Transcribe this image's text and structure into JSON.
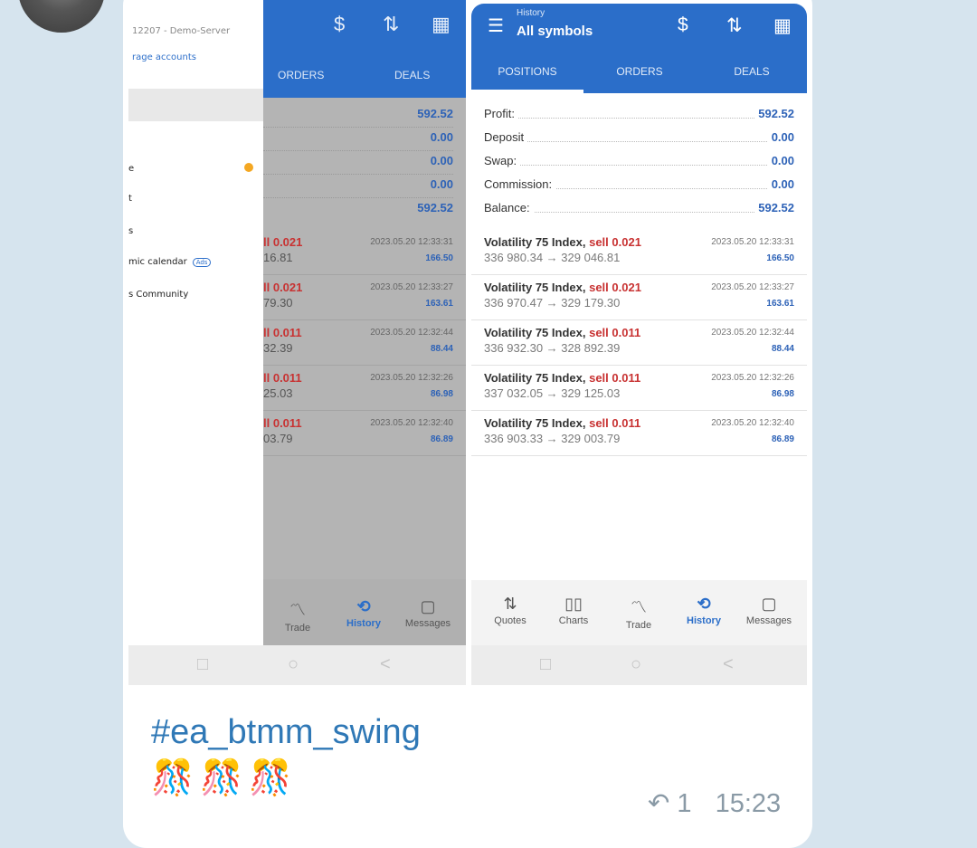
{
  "left_screen": {
    "drawer": {
      "server": "12207 - Demo-Server",
      "manage_accounts": "rage accounts",
      "items": [
        "e",
        "t",
        "s",
        "mic calendar",
        "s Community"
      ],
      "ads_badge": "Ads"
    },
    "tabs": [
      "ORDERS",
      "DEALS"
    ],
    "summary_values": [
      "592.52",
      "0.00",
      "0.00",
      "0.00",
      "592.52"
    ],
    "deals": [
      {
        "type": "ll 0.021",
        "prices": "16.81",
        "time": "2023.05.20 12:33:31",
        "profit": "166.50"
      },
      {
        "type": "ll 0.021",
        "prices": "79.30",
        "time": "2023.05.20 12:33:27",
        "profit": "163.61"
      },
      {
        "type": "ll 0.011",
        "prices": "32.39",
        "time": "2023.05.20 12:32:44",
        "profit": "88.44"
      },
      {
        "type": "ll 0.011",
        "prices": "25.03",
        "time": "2023.05.20 12:32:26",
        "profit": "86.98"
      },
      {
        "type": "ll 0.011",
        "prices": "03.79",
        "time": "2023.05.20 12:32:40",
        "profit": "86.89"
      }
    ],
    "nav": [
      "Trade",
      "History",
      "Messages"
    ]
  },
  "right_screen": {
    "header_small": "History",
    "header_title": "All symbols",
    "tabs": [
      "POSITIONS",
      "ORDERS",
      "DEALS"
    ],
    "summary": [
      {
        "label": "Profit:",
        "value": "592.52"
      },
      {
        "label": "Deposit",
        "value": "0.00"
      },
      {
        "label": "Swap:",
        "value": "0.00"
      },
      {
        "label": "Commission:",
        "value": "0.00"
      },
      {
        "label": "Balance:",
        "value": "592.52"
      }
    ],
    "deals": [
      {
        "symbol": "Volatility 75 Index,",
        "side": "sell 0.021",
        "prices": "336 980.34 → 329 046.81",
        "time": "2023.05.20 12:33:31",
        "profit": "166.50"
      },
      {
        "symbol": "Volatility 75 Index,",
        "side": "sell 0.021",
        "prices": "336 970.47 → 329 179.30",
        "time": "2023.05.20 12:33:27",
        "profit": "163.61"
      },
      {
        "symbol": "Volatility 75 Index,",
        "side": "sell 0.011",
        "prices": "336 932.30 → 328 892.39",
        "time": "2023.05.20 12:32:44",
        "profit": "88.44"
      },
      {
        "symbol": "Volatility 75 Index,",
        "side": "sell 0.011",
        "prices": "337 032.05 → 329 125.03",
        "time": "2023.05.20 12:32:26",
        "profit": "86.98"
      },
      {
        "symbol": "Volatility 75 Index,",
        "side": "sell 0.011",
        "prices": "336 903.33 → 329 003.79",
        "time": "2023.05.20 12:32:40",
        "profit": "86.89"
      }
    ],
    "nav": [
      "Quotes",
      "Charts",
      "Trade",
      "History",
      "Messages"
    ]
  },
  "caption": {
    "hashtag": "#ea_btmm_swing",
    "emoji": [
      "🎊",
      "🎊",
      "🎊"
    ]
  },
  "meta": {
    "reply_count": "1",
    "time": "15:23"
  },
  "colors": {
    "accent_blue": "#2b6ec9",
    "profit_blue": "#2d62b7",
    "sell_red": "#c83232",
    "hashtag_blue": "#2f78b6"
  }
}
